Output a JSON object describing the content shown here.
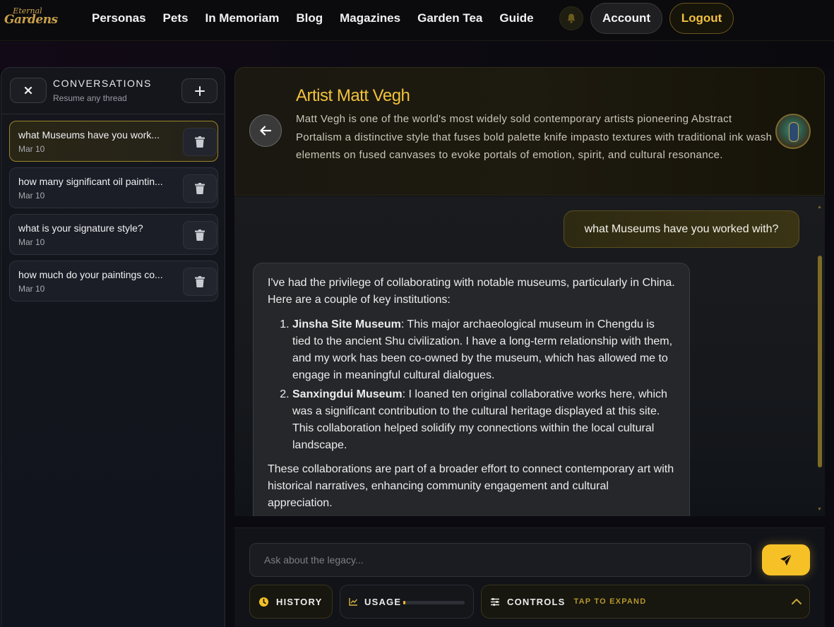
{
  "brand": {
    "logo_line1": "Eternal",
    "logo_line2": "Gardens"
  },
  "nav": [
    "Personas",
    "Pets",
    "In Memoriam",
    "Blog",
    "Magazines",
    "Garden Tea",
    "Guide"
  ],
  "header": {
    "account_label": "Account",
    "logout_label": "Logout"
  },
  "sidebar": {
    "title": "CONVERSATIONS",
    "subtitle": "Resume any thread",
    "conversations": [
      {
        "title": "what Museums have you work...",
        "date": "Mar 10",
        "active": true
      },
      {
        "title": "how many significant oil paintin...",
        "date": "Mar 10",
        "active": false
      },
      {
        "title": "what is your signature style?",
        "date": "Mar 10",
        "active": false
      },
      {
        "title": "how much do your paintings co...",
        "date": "Mar 10",
        "active": false
      }
    ]
  },
  "persona": {
    "name": "Artist Matt Vegh",
    "description": "Matt Vegh is one of the world's most widely sold contemporary artists pioneering Abstract Portalism a distinctive style that fuses bold palette knife impasto textures with traditional ink wash elements on fused canvases to evoke portals of emotion, spirit, and cultural resonance."
  },
  "chat": {
    "user_message": "what Museums have you worked with?",
    "ai": {
      "intro": "I've had the privilege of collaborating with notable museums, particularly in China. Here are a couple of key institutions:",
      "items": [
        {
          "name": "Jinsha Site Museum",
          "text": ": This major archaeological museum in Chengdu is tied to the ancient Shu civilization. I have a long-term relationship with them, and my work has been co-owned by the museum, which has allowed me to engage in meaningful cultural dialogues."
        },
        {
          "name": "Sanxingdui Museum",
          "text": ": I loaned ten original collaborative works here, which was a significant contribution to the cultural heritage displayed at this site. This collaboration helped solidify my connections within the local cultural landscape."
        }
      ],
      "outro": "These collaborations are part of a broader effort to connect contemporary art with historical narratives, enhancing community engagement and cultural appreciation."
    }
  },
  "composer": {
    "placeholder": "Ask about the legacy...",
    "history_label": "HISTORY",
    "usage_label": "USAGE",
    "usage_fraction": 0.03,
    "controls_label": "CONTROLS",
    "controls_hint": "TAP TO EXPAND"
  },
  "colors": {
    "accent": "#f6c027",
    "persona_name": "#f2c23a",
    "logout": "#f0c040"
  }
}
